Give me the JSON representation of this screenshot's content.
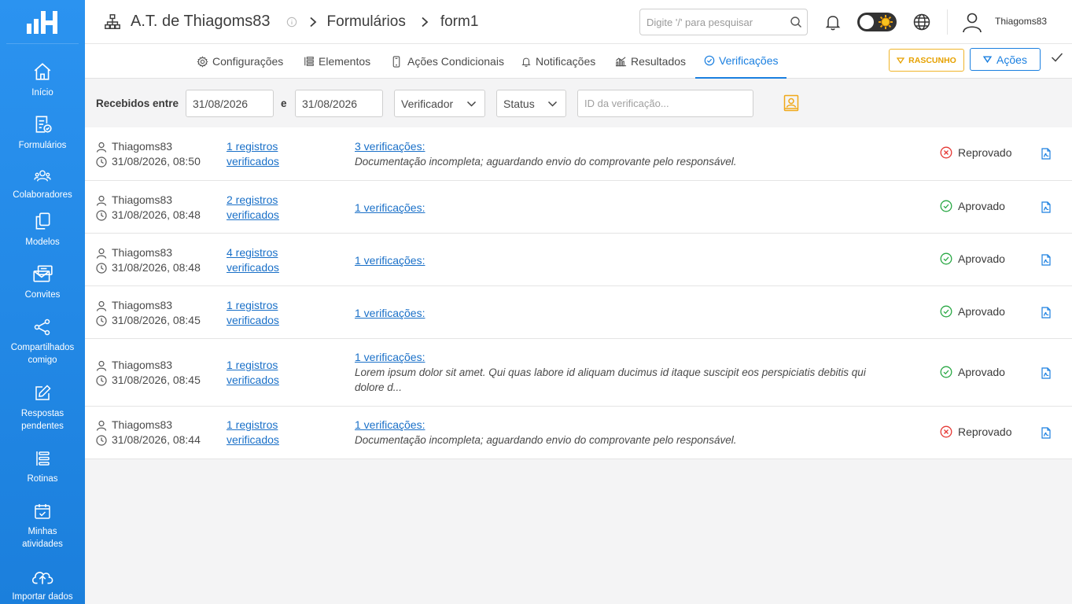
{
  "sidebar": {
    "items": [
      {
        "label": "Início",
        "icon": "home-icon"
      },
      {
        "label": "Formulários",
        "icon": "form-check-icon"
      },
      {
        "label": "Colaboradores",
        "icon": "users-icon"
      },
      {
        "label": "Modelos",
        "icon": "copy-icon"
      },
      {
        "label": "Convites",
        "icon": "mail-icon"
      },
      {
        "label": "Compartilhados comigo",
        "icon": "share-icon"
      },
      {
        "label": "Respostas pendentes",
        "icon": "edit-icon"
      },
      {
        "label": "Rotinas",
        "icon": "list-icon"
      },
      {
        "label": "Minhas atividades",
        "icon": "calendar-check-icon"
      },
      {
        "label": "Importar dados",
        "icon": "cloud-upload-icon"
      }
    ]
  },
  "header": {
    "org_title": "A.T. de Thiagoms83",
    "crumb_forms": "Formulários",
    "crumb_form": "form1",
    "search_placeholder": "Digite '/' para pesquisar",
    "username": "Thiagoms83"
  },
  "tabs": [
    {
      "label": "Configurações",
      "icon": "gear-icon",
      "active": false
    },
    {
      "label": "Elementos",
      "icon": "list-icon",
      "active": false
    },
    {
      "label": "Ações Condicionais",
      "icon": "phone-icon",
      "active": false
    },
    {
      "label": "Notificações",
      "icon": "bell-icon",
      "active": false
    },
    {
      "label": "Resultados",
      "icon": "chart-icon",
      "active": false
    },
    {
      "label": "Verificações",
      "icon": "check-circle-icon",
      "active": true
    }
  ],
  "actions": {
    "rascunho_label": "RASCUNHO",
    "acoes_label": "Ações"
  },
  "filters": {
    "received_between_label": "Recebidos entre",
    "date_from": "31/08/2026",
    "and_label": "e",
    "date_to": "31/08/2026",
    "verifier_placeholder": "Verificador",
    "status_placeholder": "Status",
    "id_placeholder": "ID da verificação..."
  },
  "rows": [
    {
      "user": "Thiagoms83",
      "datetime": "31/08/2026, 08:50",
      "records": "1 registros",
      "records2": "verificados",
      "verifications": "3 verificações:",
      "observation": "Documentação incompleta; aguardando envio do comprovante pelo responsável.",
      "status": "Reprovado",
      "status_kind": "rejected"
    },
    {
      "user": "Thiagoms83",
      "datetime": "31/08/2026, 08:48",
      "records": "2 registros",
      "records2": "verificados",
      "verifications": "1 verificações:",
      "observation": "",
      "status": "Aprovado",
      "status_kind": "approved"
    },
    {
      "user": "Thiagoms83",
      "datetime": "31/08/2026, 08:48",
      "records": "4 registros",
      "records2": "verificados",
      "verifications": "1 verificações:",
      "observation": "",
      "status": "Aprovado",
      "status_kind": "approved"
    },
    {
      "user": "Thiagoms83",
      "datetime": "31/08/2026, 08:45",
      "records": "1 registros",
      "records2": "verificados",
      "verifications": "1 verificações:",
      "observation": "",
      "status": "Aprovado",
      "status_kind": "approved"
    },
    {
      "user": "Thiagoms83",
      "datetime": "31/08/2026, 08:45",
      "records": "1 registros",
      "records2": "verificados",
      "verifications": "1 verificações:",
      "observation": "Lorem ipsum dolor sit amet. Qui quas labore id aliquam ducimus id itaque suscipit eos perspiciatis debitis qui dolore d...",
      "status": "Aprovado",
      "status_kind": "approved"
    },
    {
      "user": "Thiagoms83",
      "datetime": "31/08/2026, 08:44",
      "records": "1 registros",
      "records2": "verificados",
      "verifications": "1 verificações:",
      "observation": "Documentação incompleta; aguardando envio do comprovante pelo responsável.",
      "status": "Reprovado",
      "status_kind": "rejected"
    }
  ],
  "colors": {
    "sidebar": "#2b93f0",
    "accent": "#1a7fe0",
    "link": "#1a70c8",
    "approved": "#2aa845",
    "rejected": "#e53935",
    "draft": "#f0b429"
  }
}
